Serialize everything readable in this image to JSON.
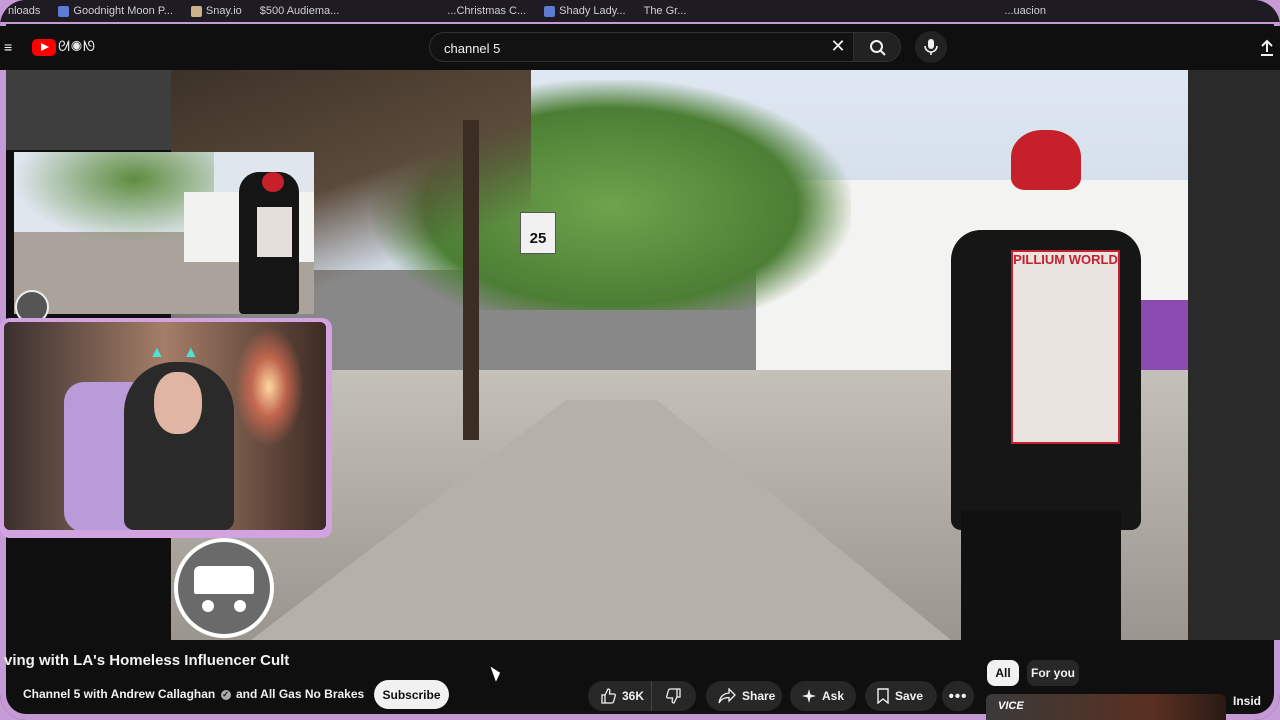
{
  "bookmarks": [
    {
      "label": "nloads"
    },
    {
      "label": "Goodnight Moon P..."
    },
    {
      "label": "Snay.io"
    },
    {
      "label": "$500 Audiema..."
    },
    {
      "label": "...Christmas C..."
    },
    {
      "label": "Shady Lady..."
    },
    {
      "label": "The Gr..."
    },
    {
      "label": "...uacion"
    }
  ],
  "header": {
    "search_value": "channel 5",
    "logo_deco": "ᘛ◉ᘚ"
  },
  "video": {
    "speed_sign": "25",
    "patch_text": "PILLIUM WORLD",
    "title": "ving with LA's Homeless Influencer Cult",
    "channel": "Channel 5 with Andrew Callaghan",
    "channel_suffix": "and All Gas No Brakes",
    "verified_glyph": "✓",
    "subscribe_label": "Subscribe"
  },
  "actions": {
    "likes": "36K",
    "share_label": "Share",
    "ask_label": "Ask",
    "save_label": "Save",
    "more_label": "•••"
  },
  "chips": {
    "all": "All",
    "for_you": "For you"
  },
  "sidebar": {
    "thumb_text": "VICE",
    "next_channel": "Insid"
  },
  "webcam": {
    "ears": "▲▲"
  }
}
